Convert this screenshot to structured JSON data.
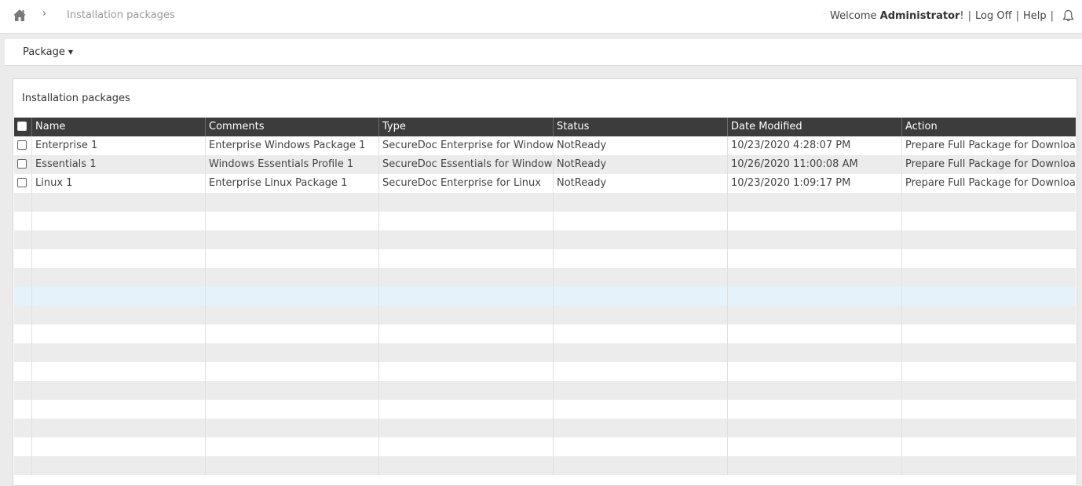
{
  "breadcrumb": {
    "separator": "›",
    "title": "Installation packages"
  },
  "user": {
    "welcome": "Welcome",
    "name": "Administrator",
    "exclaim": "!",
    "logoff": "Log Off",
    "help": "Help",
    "sep": "|"
  },
  "menu": {
    "package": "Package",
    "caret": "▼"
  },
  "panel": {
    "title": "Installation packages"
  },
  "grid": {
    "headers": [
      "Name",
      "Comments",
      "Type",
      "Status",
      "Date Modified",
      "Action"
    ],
    "rows": [
      [
        "Enterprise 1",
        "Enterprise Windows Package 1",
        "SecureDoc Enterprise for Windows",
        "NotReady",
        "10/23/2020 4:28:07 PM",
        "Prepare Full Package for Download"
      ],
      [
        "Essentials 1",
        "Windows Essentials Profile 1",
        "SecureDoc Essentials for Windows",
        "NotReady",
        "10/26/2020 11:00:08 AM",
        "Prepare Full Package for Download"
      ],
      [
        "Linux 1",
        "Enterprise Linux Package 1",
        "SecureDoc Enterprise for Linux",
        "NotReady",
        "10/23/2020 1:09:17 PM",
        "Prepare Full Package for Download"
      ]
    ],
    "empty_rows": 15,
    "highlighted_empty_row": 5
  },
  "icons": {
    "home": "home-icon",
    "bell": "bell-icon"
  },
  "colors": {
    "header_bg": "#3c3c3c",
    "row_alt": "#ececec",
    "row_highlight": "#e5f2fa"
  }
}
